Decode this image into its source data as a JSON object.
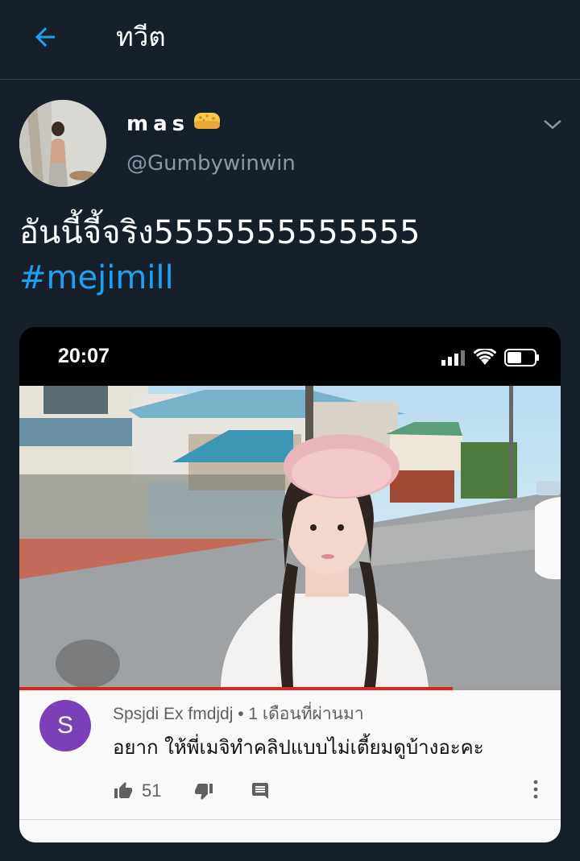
{
  "header": {
    "title": "ทวีต",
    "back_icon": "arrow-left-icon",
    "accent_color": "#1da1f2"
  },
  "tweet": {
    "display_name": "mas",
    "name_emoji_icon": "sponge-icon",
    "username": "@Gumbywinwin",
    "text": "อันนี้จี้จริง5555555555555",
    "hashtag": "#mejimill",
    "menu_icon": "chevron-down-icon"
  },
  "media": {
    "status_time": "20:07",
    "status_icons": [
      "signal-icon",
      "wifi-icon",
      "battery-icon"
    ],
    "video_progress": 0.8,
    "comment": {
      "avatar_letter": "S",
      "avatar_color": "#7b3fb7",
      "meta": "Spsjdi Ex fmdjdj • 1 เดือนที่ผ่านมา",
      "text": "อยาก ให้พี่เมจิทำคลิปแบบไม่เตี้ยมดูบ้างอะคะ",
      "like_count": "51",
      "icons": [
        "thumbs-up-icon",
        "thumbs-down-icon",
        "reply-icon",
        "more-vertical-icon"
      ]
    }
  },
  "colors": {
    "background": "#15202b",
    "divider": "#38444d",
    "secondary_text": "#8899a6"
  }
}
